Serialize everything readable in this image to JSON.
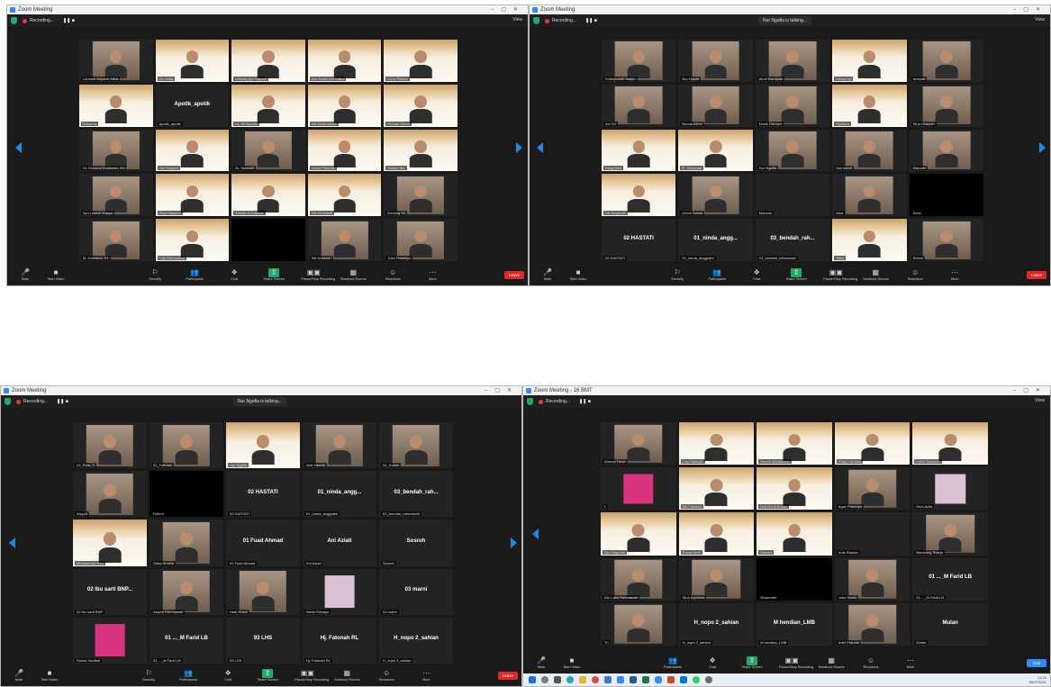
{
  "windows": [
    {
      "id": "w1",
      "title": "Zoom Meeting",
      "recording_label": "Recording...",
      "view_label": "View",
      "toast": "",
      "end_label": "Leave",
      "page_left": "",
      "page_right": "",
      "cols": 5,
      "tiles": [
        {
          "kind": "cam",
          "name": "Lauriani Ariyanti, MBA"
        },
        {
          "kind": "ppt",
          "name": "Ely Asfar"
        },
        {
          "kind": "ppt",
          "name": "Lintang Ayu Saputri"
        },
        {
          "kind": "ppt",
          "name": "Nur Asmie Alif Hafsa"
        },
        {
          "kind": "ppt",
          "name": "Enny Fitriani"
        },
        {
          "kind": "ppt",
          "name": "Suharno"
        },
        {
          "kind": "text",
          "big": "Apotik_apotik",
          "name": "Apotik_apotik"
        },
        {
          "kind": "ppt",
          "name": "Hj. Sri Nuraini"
        },
        {
          "kind": "ppt",
          "name": "Siti Muthmainah"
        },
        {
          "kind": "ppt",
          "name": "Rumah Sehat"
        },
        {
          "kind": "cam",
          "name": "Dr. Khusnul Khotimah, SH"
        },
        {
          "kind": "ppt",
          "name": "Yuli Suryani"
        },
        {
          "kind": "cam",
          "name": "Dr. Sutarsih"
        },
        {
          "kind": "ppt",
          "name": "Ummi Fatonah"
        },
        {
          "kind": "ppt",
          "name": "Rofiah Nur"
        },
        {
          "kind": "cam",
          "name": "Ayu Lestari Wijaya"
        },
        {
          "kind": "ppt",
          "name": "Dewi Masitoh"
        },
        {
          "kind": "ppt",
          "name": "Zainab Al Kautsar"
        },
        {
          "kind": "ppt",
          "name": "Siti Khoiriyah"
        },
        {
          "kind": "cam",
          "name": "Endang Sri"
        },
        {
          "kind": "cam",
          "name": "M. Hamdani, ST"
        },
        {
          "kind": "ppt",
          "name": "Lina Rahmawati"
        },
        {
          "kind": "black",
          "name": ""
        },
        {
          "kind": "cam",
          "name": "Siti Umairoh"
        },
        {
          "kind": "cam",
          "name": "Joko Prasetyo"
        }
      ],
      "toolbar": [
        {
          "glyph": "🎤",
          "label": "Mute"
        },
        {
          "glyph": "■",
          "label": "Start Video"
        },
        {
          "glyph": "⚐",
          "label": "Security"
        },
        {
          "glyph": "👥",
          "label": "Participants"
        },
        {
          "glyph": "❖",
          "label": "Chat"
        },
        {
          "glyph": "⇧",
          "label": "Share Screen"
        },
        {
          "glyph": "▣▣",
          "label": "Pause/Stop Recording"
        },
        {
          "glyph": "▦",
          "label": "Breakout Rooms"
        },
        {
          "glyph": "☺",
          "label": "Reactions"
        },
        {
          "glyph": "⋯",
          "label": "More"
        }
      ]
    },
    {
      "id": "w2",
      "title": "Zoom Meeting",
      "recording_label": "Recording...",
      "view_label": "View",
      "toast": "Nur Ngafia is talking...",
      "end_label": "Leave",
      "page_left": "",
      "page_right": "",
      "cols": 5,
      "tiles": [
        {
          "kind": "cam",
          "name": "Sulistyowati Sarjito"
        },
        {
          "kind": "cam",
          "name": "Nur Hayati"
        },
        {
          "kind": "cam",
          "name": "Ainul Mardiyah"
        },
        {
          "kind": "ppt",
          "name": "Khosyi'ah"
        },
        {
          "kind": "cam",
          "name": "Ismiyati"
        },
        {
          "kind": "cam",
          "name": "Ani Sri"
        },
        {
          "kind": "cam",
          "name": "Bunda Alifah"
        },
        {
          "kind": "cam",
          "name": "Nunik Rahayu"
        },
        {
          "kind": "ppt",
          "name": "Sutrisno"
        },
        {
          "kind": "cam",
          "name": "Rina Hidayah"
        },
        {
          "kind": "ppt",
          "name": "Kang Amir"
        },
        {
          "kind": "ppt",
          "name": "R. Sulaiman"
        },
        {
          "kind": "cam",
          "name": "Nur Ngafia"
        },
        {
          "kind": "cam",
          "name": "Dwi Astuti"
        },
        {
          "kind": "cam",
          "name": "Marwah"
        },
        {
          "kind": "ppt",
          "name": "Siti Nurjanah"
        },
        {
          "kind": "cam",
          "name": "Ummi Salma"
        },
        {
          "kind": "text",
          "big": "",
          "name": "Marwan"
        },
        {
          "kind": "cam",
          "name": "Nisa"
        },
        {
          "kind": "black",
          "name": "Dewi"
        },
        {
          "kind": "text",
          "big": "02 HASTATI",
          "name": "02 HASTATI"
        },
        {
          "kind": "text",
          "big": "01_ninda_angg...",
          "name": "01_ninda_anggraini"
        },
        {
          "kind": "text",
          "big": "03_bendah_rah...",
          "name": "03_bendah_rahmawati"
        },
        {
          "kind": "ppt",
          "name": "Santi"
        },
        {
          "kind": "cam",
          "name": "Rahmi"
        }
      ],
      "toolbar": [
        {
          "glyph": "🎤",
          "label": "Mute"
        },
        {
          "glyph": "■",
          "label": "Start Video"
        },
        {
          "glyph": "⚐",
          "label": "Security"
        },
        {
          "glyph": "👥",
          "label": "Participants"
        },
        {
          "glyph": "❖",
          "label": "Chat"
        },
        {
          "glyph": "⇧",
          "label": "Share Screen"
        },
        {
          "glyph": "▣▣",
          "label": "Pause/Stop Recording"
        },
        {
          "glyph": "▦",
          "label": "Breakout Rooms"
        },
        {
          "glyph": "☺",
          "label": "Reactions"
        },
        {
          "glyph": "⋯",
          "label": "More"
        }
      ]
    },
    {
      "id": "w3",
      "title": "Zoom Meeting",
      "recording_label": "Recording...",
      "view_label": "",
      "toast": "Nur Ngafia is talking...",
      "end_label": "Leave",
      "page_left": "",
      "page_right": "",
      "cols": 5,
      "tiles": [
        {
          "kind": "cam",
          "name": "01_Rina_S"
        },
        {
          "kind": "cam",
          "name": "02_Fatimah"
        },
        {
          "kind": "ppt",
          "name": "Nur Ngafia"
        },
        {
          "kind": "cam",
          "name": "Asih Hartati"
        },
        {
          "kind": "cam",
          "name": "04_Sultan"
        },
        {
          "kind": "cam",
          "name": "Aisyah"
        },
        {
          "kind": "black",
          "name": "Rahmi"
        },
        {
          "kind": "text",
          "big": "02 HASTATI",
          "name": "02 HASTATI"
        },
        {
          "kind": "text",
          "big": "01_ninda_angg...",
          "name": "01_ninda_anggraini"
        },
        {
          "kind": "text",
          "big": "03_bendah_rah...",
          "name": "03_bendah_rahmawati"
        },
        {
          "kind": "ppt",
          "name": "Muhammad Aryo"
        },
        {
          "kind": "cam",
          "name": "Siska Amalia"
        },
        {
          "kind": "text",
          "big": "01 Fuad Ahmad",
          "name": "01 Fuad Ahmad"
        },
        {
          "kind": "text",
          "big": "Ani Aziati",
          "name": "Ani Aziati"
        },
        {
          "kind": "text",
          "big": "Sosroh",
          "name": "Sosroh"
        },
        {
          "kind": "text",
          "big": "02 Ibu sarti BNP...",
          "name": "02 Ibu sarti BNP"
        },
        {
          "kind": "cam",
          "name": "Asiyah Rahmawati"
        },
        {
          "kind": "cam",
          "name": "Hadi Rusdi"
        },
        {
          "kind": "pink",
          "name": "Nunik Rahayu"
        },
        {
          "kind": "text",
          "big": "03 marni",
          "name": "03 marni"
        },
        {
          "kind": "magenta",
          "name": "Salma Hanifah"
        },
        {
          "kind": "text",
          "big": "01 ..._M Farid LB",
          "name": "01 ..._M Farid LB"
        },
        {
          "kind": "text",
          "big": "93 LHS",
          "name": "93 LHS"
        },
        {
          "kind": "text",
          "big": "Hj. Fatonah RL",
          "name": "Hj. Fatonah RL"
        },
        {
          "kind": "text",
          "big": "H_nopo 2_sahian",
          "name": "H_nopo 2_sahian"
        }
      ],
      "toolbar": [
        {
          "glyph": "🎤",
          "label": "Mute"
        },
        {
          "glyph": "■",
          "label": "Start Video"
        },
        {
          "glyph": "⚐",
          "label": "Security"
        },
        {
          "glyph": "👥",
          "label": "Participants"
        },
        {
          "glyph": "❖",
          "label": "Chat"
        },
        {
          "glyph": "⇧",
          "label": "Share Screen"
        },
        {
          "glyph": "▣▣",
          "label": "Pause/Stop Recording"
        },
        {
          "glyph": "▦",
          "label": "Breakout Rooms"
        },
        {
          "glyph": "☺",
          "label": "Reactions"
        },
        {
          "glyph": "⋯",
          "label": "More"
        }
      ]
    },
    {
      "id": "w4",
      "title": "Zoom Meeting - 16 BMT",
      "recording_label": "Recording...",
      "view_label": "View",
      "toast": "",
      "end_label": "End",
      "page_left": "",
      "page_right": "",
      "cols": 5,
      "tiles": [
        {
          "kind": "cam",
          "name": "Ahmad Fauzi"
        },
        {
          "kind": "ppt",
          "name": "Lina Sakinah"
        },
        {
          "kind": "ppt",
          "name": "Hendri Wicaksono"
        },
        {
          "kind": "ppt",
          "name": "Rudy Harianto"
        },
        {
          "kind": "ppt",
          "name": "Kasih Daryono"
        },
        {
          "kind": "magenta",
          "name": "L"
        },
        {
          "kind": "ppt",
          "name": "Siti Fatimah"
        },
        {
          "kind": "ppt",
          "name": "Umi Nurul Amani"
        },
        {
          "kind": "cam",
          "name": "Agus Prasetyo"
        },
        {
          "kind": "pink",
          "name": "Dina Aulia"
        },
        {
          "kind": "ppt",
          "name": "Eko Nugroho"
        },
        {
          "kind": "ppt",
          "name": "Ratna Dewi"
        },
        {
          "kind": "ppt",
          "name": "Warsini"
        },
        {
          "kind": "text",
          "big": "",
          "name": "Anis Rahma"
        },
        {
          "kind": "cam",
          "name": "Bambang Sutejo"
        },
        {
          "kind": "cam",
          "name": "Nur Laila Rahmawati"
        },
        {
          "kind": "cam",
          "name": "Rina Agustina"
        },
        {
          "kind": "black",
          "name": "Wulandari"
        },
        {
          "kind": "cam",
          "name": "Joko Susilo"
        },
        {
          "kind": "text",
          "big": "01 ..._M Farid LB",
          "name": "01 ..._M Farid LB"
        },
        {
          "kind": "cam",
          "name": "Tri"
        },
        {
          "kind": "text",
          "big": "H_nopo 2_sahian",
          "name": "H_nopo 2_sahian"
        },
        {
          "kind": "text",
          "big": "M hendian_LMB",
          "name": "M hendian_LMB"
        },
        {
          "kind": "cam",
          "name": "Arief Pranoto"
        },
        {
          "kind": "text",
          "big": "Mulan",
          "name": "Mulan"
        }
      ],
      "toolbar": [
        {
          "glyph": "🎤",
          "label": "Mute"
        },
        {
          "glyph": "■",
          "label": "Start Video"
        },
        {
          "glyph": "👥",
          "label": "Participants"
        },
        {
          "glyph": "❖",
          "label": "Chat"
        },
        {
          "glyph": "⇧",
          "label": "Share Screen"
        },
        {
          "glyph": "▣▣",
          "label": "Pause/Stop Recording"
        },
        {
          "glyph": "▦",
          "label": "Breakout Rooms"
        },
        {
          "glyph": "☺",
          "label": "Reactions"
        },
        {
          "glyph": "⋯",
          "label": "More"
        }
      ],
      "tray_time": "11:10",
      "tray_date": "15/07/2021"
    }
  ],
  "colors": {
    "zoom_blue": "#2d8cff",
    "share_green": "#23a86b",
    "end_red": "#e02828",
    "nav_arrow": "#1e88e5"
  }
}
